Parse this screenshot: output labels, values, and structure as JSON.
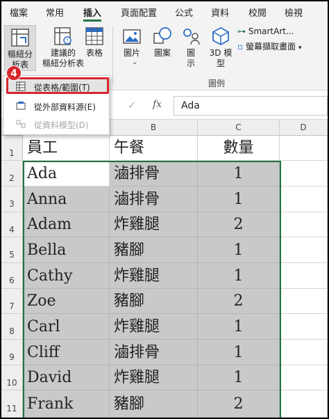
{
  "menu": {
    "tabs": [
      {
        "label": "檔案"
      },
      {
        "label": "常用"
      },
      {
        "label": "插入"
      },
      {
        "label": "頁面配置"
      },
      {
        "label": "公式"
      },
      {
        "label": "資料"
      },
      {
        "label": "校閱"
      },
      {
        "label": "檢視"
      }
    ]
  },
  "ribbon": {
    "pivot_line1": "樞紐分",
    "pivot_line2": "析表",
    "recommended_line1": "建議的",
    "recommended_line2": "樞紐分析表",
    "table": "表格",
    "pictures": "圖片",
    "shapes": "圖案",
    "icons_line1": "圖",
    "icons_line2": "示",
    "models_line1": "3D 模",
    "models_line2": "型",
    "smartart": "SmartArt...",
    "screenshot": "螢幕擷取畫面",
    "illustrations_group": "圖例"
  },
  "dropdown": {
    "items": [
      {
        "label": "從表格/範圍(T)"
      },
      {
        "label": "從外部資料源(E)"
      },
      {
        "label": "從資料模型(D)"
      }
    ]
  },
  "step_badge": "4",
  "formula_bar": {
    "fx_label": "fx",
    "value": "Ada"
  },
  "sheet": {
    "columns": [
      "B",
      "C",
      "D"
    ],
    "rows": [
      {
        "num": "1",
        "name": "員工",
        "meal": "午餐",
        "qty": "數量"
      },
      {
        "num": "2",
        "name": "Ada",
        "meal": "滷排骨",
        "qty": "1"
      },
      {
        "num": "3",
        "name": "Anna",
        "meal": "滷排骨",
        "qty": "1"
      },
      {
        "num": "4",
        "name": "Adam",
        "meal": "炸雞腿",
        "qty": "2"
      },
      {
        "num": "5",
        "name": "Bella",
        "meal": "豬腳",
        "qty": "1"
      },
      {
        "num": "6",
        "name": "Cathy",
        "meal": "炸雞腿",
        "qty": "1"
      },
      {
        "num": "7",
        "name": "Zoe",
        "meal": "豬腳",
        "qty": "2"
      },
      {
        "num": "8",
        "name": "Carl",
        "meal": "炸雞腿",
        "qty": "1"
      },
      {
        "num": "9",
        "name": "Cliff",
        "meal": "滷排骨",
        "qty": "1"
      },
      {
        "num": "10",
        "name": "David",
        "meal": "炸雞腿",
        "qty": "1"
      },
      {
        "num": "11",
        "name": "Frank",
        "meal": "豬腳",
        "qty": "2"
      }
    ]
  },
  "colors": {
    "accent_green": "#217346",
    "highlight_red": "#d9262c",
    "selection_gray": "#c9c9c9"
  }
}
